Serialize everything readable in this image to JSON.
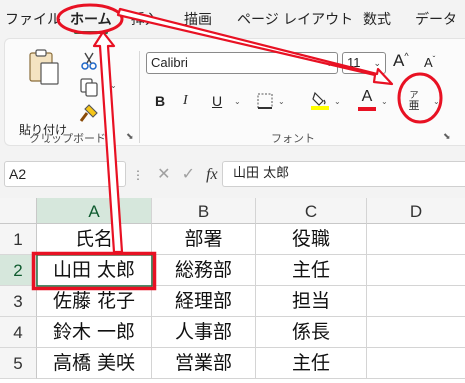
{
  "menu": {
    "tabs": [
      {
        "label": "ファイル"
      },
      {
        "label": "ホーム"
      },
      {
        "label": "挿入"
      },
      {
        "label": "描画"
      },
      {
        "label": "ページ レイアウト"
      },
      {
        "label": "数式"
      },
      {
        "label": "データ"
      }
    ],
    "active_tab": "ホーム"
  },
  "ribbon": {
    "clipboard": {
      "paste_label": "貼り付け",
      "group_label": "クリップボード"
    },
    "font": {
      "font_name": "Calibri",
      "font_size": "11",
      "bold": "B",
      "italic": "I",
      "underline": "U",
      "font_color_glyph": "A",
      "grow_glyph": "A",
      "shrink_glyph": "A",
      "furigana_glyph_top": "ア",
      "furigana_glyph_bottom": "亜",
      "group_label": "フォント"
    },
    "colors": {
      "highlight": "#ffff00",
      "font_color": "#e81123"
    }
  },
  "formula_bar": {
    "name_box": "A2",
    "fx": "fx",
    "content": "山田 太郎"
  },
  "sheet": {
    "columns": [
      "A",
      "B",
      "C",
      "D"
    ],
    "rows": [
      "1",
      "2",
      "3",
      "4",
      "5"
    ],
    "cells": [
      [
        "氏名",
        "部署",
        "役職"
      ],
      [
        "山田 太郎",
        "総務部",
        "主任"
      ],
      [
        "佐藤 花子",
        "経理部",
        "担当"
      ],
      [
        "鈴木 一郎",
        "人事部",
        "係長"
      ],
      [
        "高橋 美咲",
        "営業部",
        "主任"
      ]
    ],
    "selected_cell": "A2"
  },
  "annotation_color": "#e81123"
}
